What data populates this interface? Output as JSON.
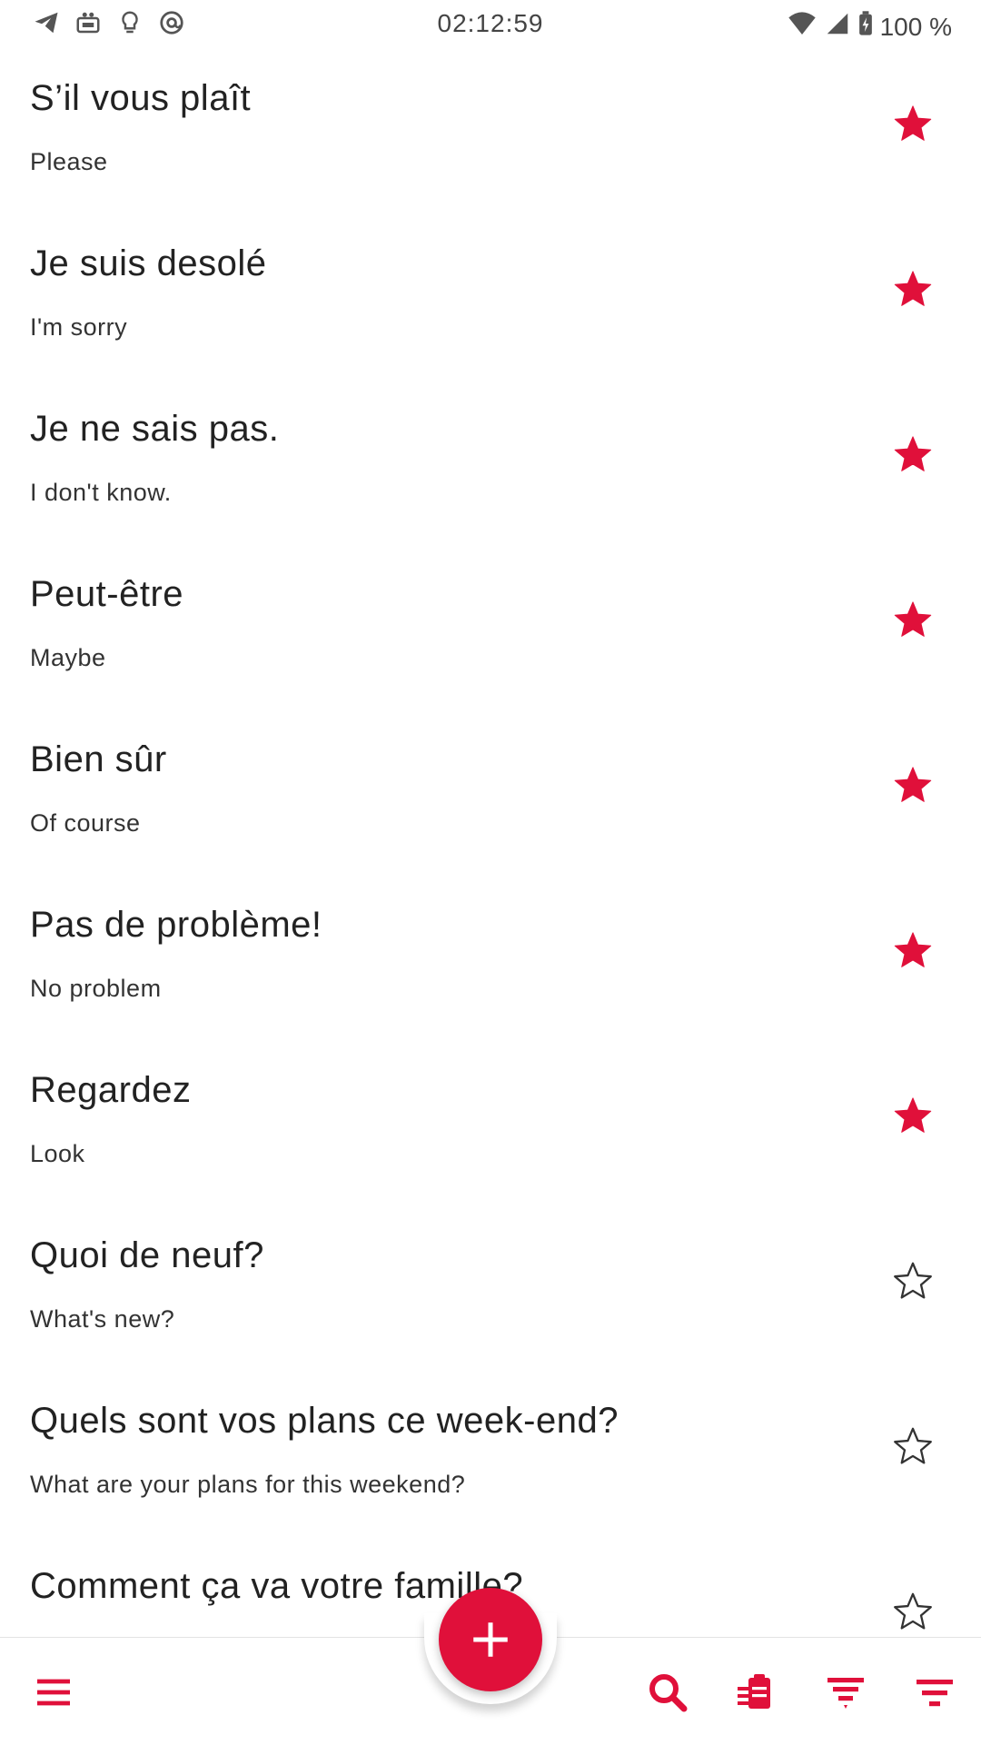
{
  "status_bar": {
    "time": "02:12:59",
    "battery": "100 %",
    "left_icons": [
      "telegram-icon",
      "game-icon",
      "bulb-icon",
      "at-sign-icon"
    ],
    "right_icons": [
      "wifi-icon",
      "signal-icon",
      "battery-icon"
    ]
  },
  "phrases": [
    {
      "title": "S’il vous plaît",
      "subtitle": "Please",
      "favorite": true
    },
    {
      "title": "Je suis desolé",
      "subtitle": "I'm sorry",
      "favorite": true
    },
    {
      "title": "Je ne sais pas.",
      "subtitle": "I don't know.",
      "favorite": true
    },
    {
      "title": "Peut-être",
      "subtitle": "Maybe",
      "favorite": true
    },
    {
      "title": "Bien sûr",
      "subtitle": "Of course",
      "favorite": true
    },
    {
      "title": "Pas de problème!",
      "subtitle": "No problem",
      "favorite": true
    },
    {
      "title": "Regardez",
      "subtitle": "Look",
      "favorite": true
    },
    {
      "title": "Quoi de neuf?",
      "subtitle": "What's new?",
      "favorite": false
    },
    {
      "title": "Quels sont vos plans ce week-end?",
      "subtitle": "What are your plans for this weekend?",
      "favorite": false
    },
    {
      "title": "Comment ça va votre famille?",
      "subtitle": "",
      "favorite": false
    }
  ],
  "colors": {
    "accent": "#e0103a",
    "star_filled": "#e0103a",
    "star_outline": "#333333"
  },
  "bottom_bar": {
    "left": "menu-icon",
    "fab": "add-icon",
    "right": [
      "search-icon",
      "clipboard-icon",
      "filter-icon",
      "sort-icon"
    ]
  }
}
